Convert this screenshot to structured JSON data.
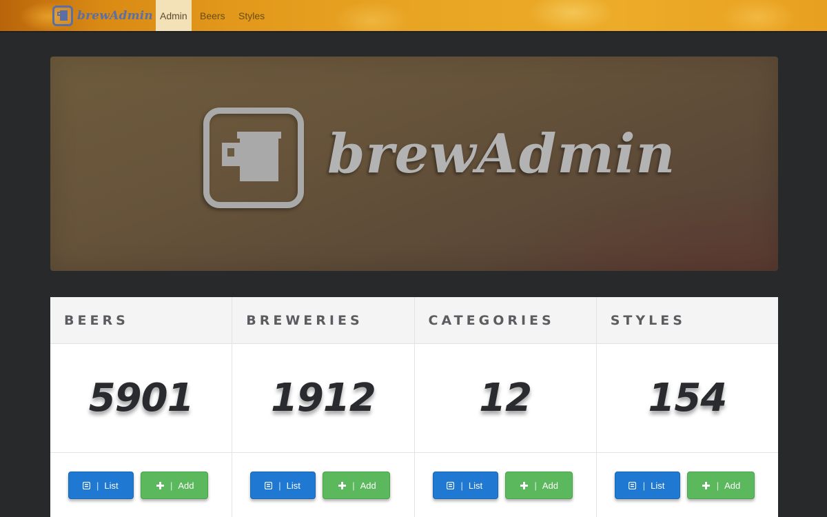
{
  "nav": {
    "brand": "brewAdmin",
    "tabs": [
      {
        "label": "Admin",
        "active": true
      },
      {
        "label": "Beers",
        "active": false
      },
      {
        "label": "Styles",
        "active": false
      }
    ]
  },
  "hero": {
    "title": "brewAdmin"
  },
  "stats": [
    {
      "heading": "BEERS",
      "value": "5901",
      "list_label": "List",
      "add_label": "Add"
    },
    {
      "heading": "BREWERIES",
      "value": "1912",
      "list_label": "List",
      "add_label": "Add"
    },
    {
      "heading": "CATEGORIES",
      "value": "12",
      "list_label": "List",
      "add_label": "Add"
    },
    {
      "heading": "STYLES",
      "value": "154",
      "list_label": "List",
      "add_label": "Add"
    }
  ],
  "colors": {
    "list_button": "#1f78d1",
    "add_button": "#5cb85c",
    "nav_active": "#f3e1b8",
    "logo": "#a9a9a9"
  },
  "icons": {
    "list": "list-icon",
    "add": "plus-icon",
    "logo": "beer-mug-icon"
  }
}
